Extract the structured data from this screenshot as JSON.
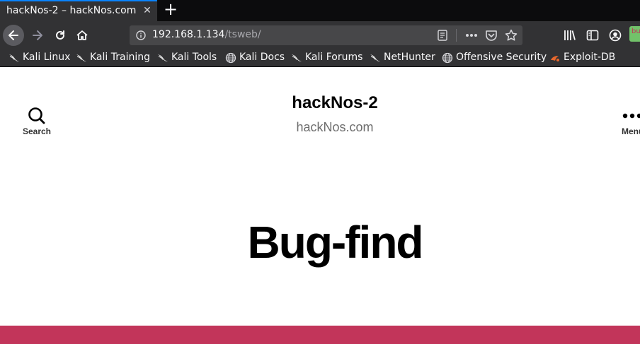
{
  "browser": {
    "tab": {
      "title": "hackNos-2 – hackNos.com",
      "close": "✕"
    },
    "new_tab": "+",
    "url": {
      "host": "192.168.1.134",
      "path": "/tsweb/"
    },
    "bookmarks": [
      {
        "label": "Kali Linux",
        "icon": "kali-dragon-icon"
      },
      {
        "label": "Kali Training",
        "icon": "kali-dragon-icon"
      },
      {
        "label": "Kali Tools",
        "icon": "kali-dragon-icon"
      },
      {
        "label": "Kali Docs",
        "icon": "globe-icon"
      },
      {
        "label": "Kali Forums",
        "icon": "kali-dragon-icon"
      },
      {
        "label": "NetHunter",
        "icon": "kali-dragon-icon"
      },
      {
        "label": "Offensive Security",
        "icon": "globe-icon"
      },
      {
        "label": "Exploit-DB",
        "icon": "exploit-db-icon"
      }
    ]
  },
  "site": {
    "title": "hackNos-2",
    "description": "hackNos.com",
    "search_label": "Search",
    "menu_label": "Menu",
    "hero_title": "Bug-find"
  },
  "colors": {
    "accent": "#0a84ff",
    "banner": "#c2355a",
    "toolbar": "#323234",
    "tabstrip": "#0c0c0d"
  }
}
